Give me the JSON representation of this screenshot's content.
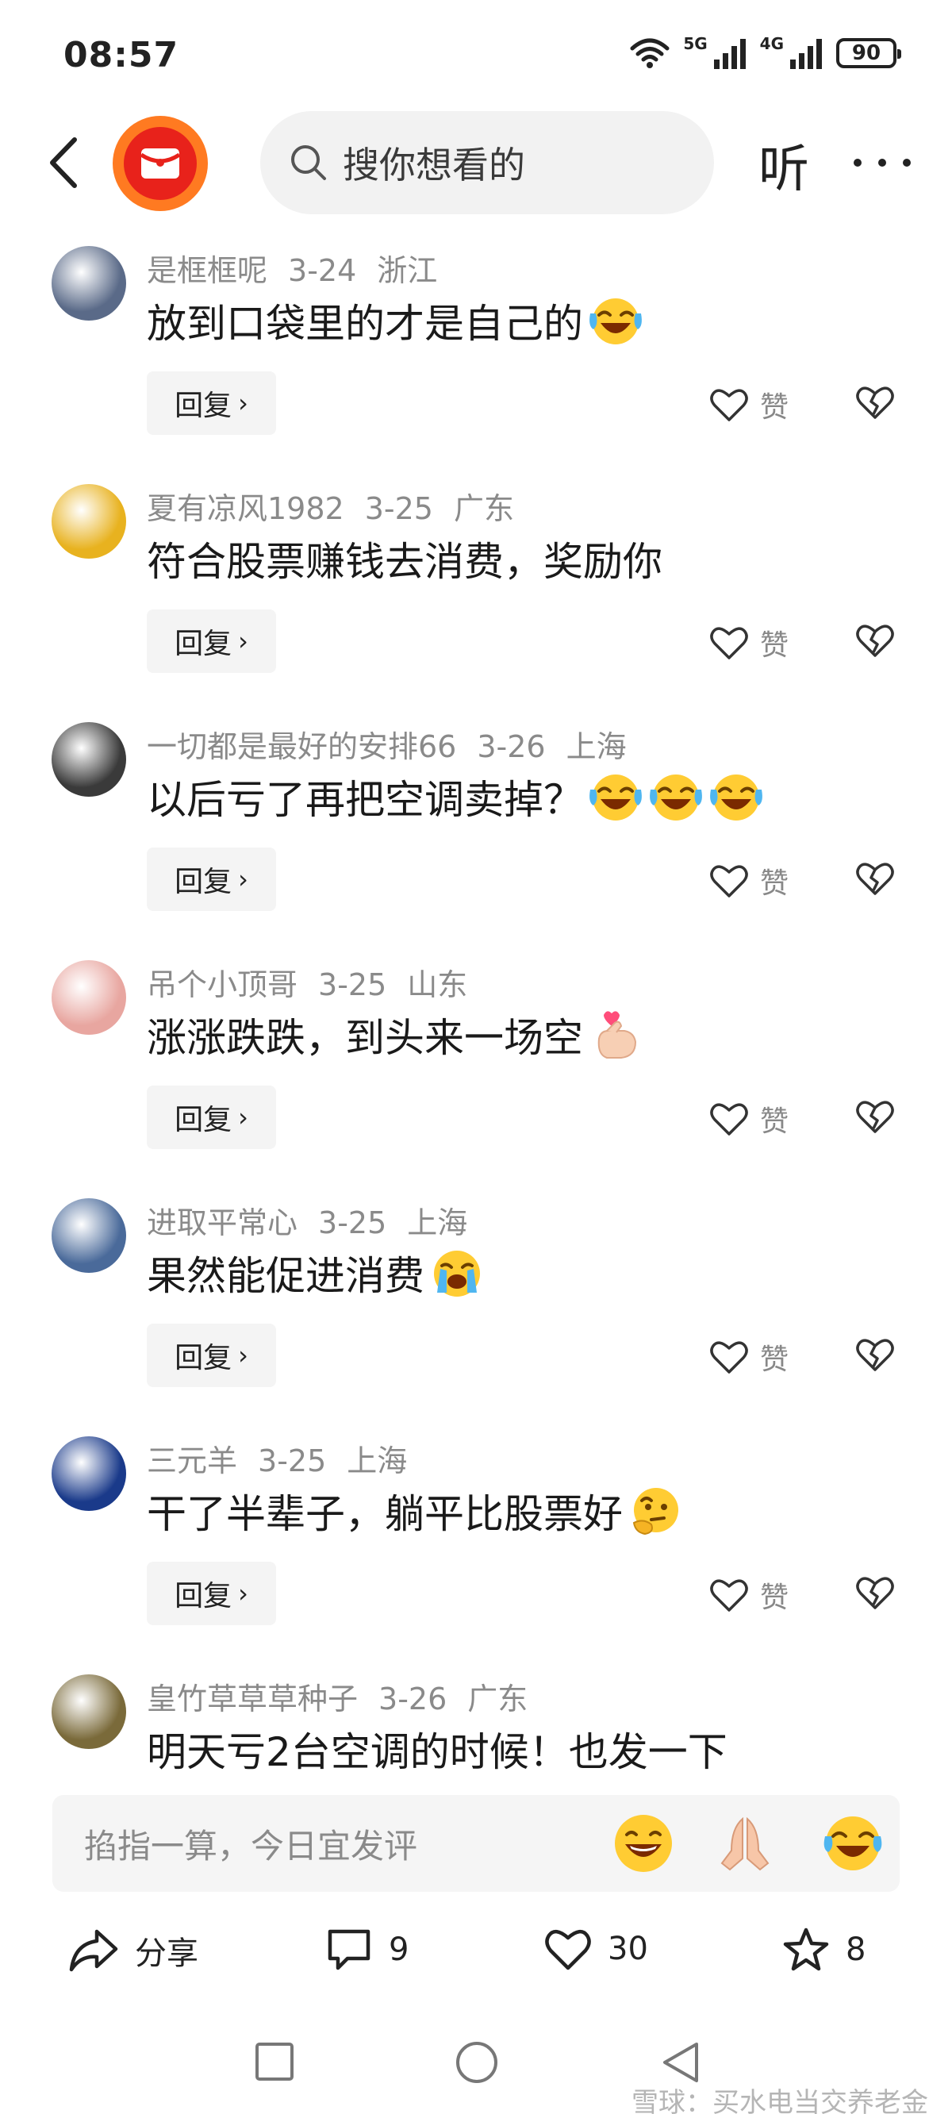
{
  "status_bar": {
    "time": "08:57",
    "network_1": "5G",
    "network_2": "4G",
    "battery": "90"
  },
  "header": {
    "search_placeholder": "搜你想看的",
    "listen_label": "听"
  },
  "comments": [
    {
      "user": "是框框呢",
      "date": "3-24",
      "location": "浙江",
      "text": "放到口袋里的才是自己的",
      "emojis": [
        "laughing-crying"
      ],
      "reply": "回复",
      "like": "赞",
      "avatar_color": "#5a6a88"
    },
    {
      "user": "夏有凉风1982",
      "date": "3-25",
      "location": "广东",
      "text": "符合股票赚钱去消费，奖励你",
      "emojis": [],
      "reply": "回复",
      "like": "赞",
      "avatar_color": "#e8b21f"
    },
    {
      "user": "一切都是最好的安排66",
      "date": "3-26",
      "location": "上海",
      "text": "以后亏了再把空调卖掉？",
      "emojis": [
        "laughing-crying",
        "laughing-crying",
        "laughing-crying"
      ],
      "reply": "回复",
      "like": "赞",
      "avatar_color": "#3a3a3a"
    },
    {
      "user": "吊个小顶哥",
      "date": "3-25",
      "location": "山东",
      "text": "涨涨跌跌，到头来一场空",
      "emojis": [
        "finger-heart"
      ],
      "reply": "回复",
      "like": "赞",
      "avatar_color": "#e8a6a0"
    },
    {
      "user": "进取平常心",
      "date": "3-25",
      "location": "上海",
      "text": "果然能促进消费",
      "emojis": [
        "crying-face"
      ],
      "reply": "回复",
      "like": "赞",
      "avatar_color": "#4a6a9a"
    },
    {
      "user": "三元羊",
      "date": "3-25",
      "location": "上海",
      "text": "干了半辈子，躺平比股票好",
      "emojis": [
        "thinking-face"
      ],
      "reply": "回复",
      "like": "赞",
      "avatar_color": "#1a3a8a"
    },
    {
      "user": "皇竹草草草种子",
      "date": "3-26",
      "location": "广东",
      "text": "明天亏2台空调的时候！也发一下",
      "emojis": [],
      "reply": "回复",
      "like": "赞",
      "avatar_color": "#7a6a3a"
    }
  ],
  "input_bar": {
    "placeholder": "掐指一算，今日宜发评"
  },
  "actions": {
    "share": "分享",
    "comments": "9",
    "likes": "30",
    "favorites": "8"
  },
  "watermark": "雪球：买水电当交养老金"
}
